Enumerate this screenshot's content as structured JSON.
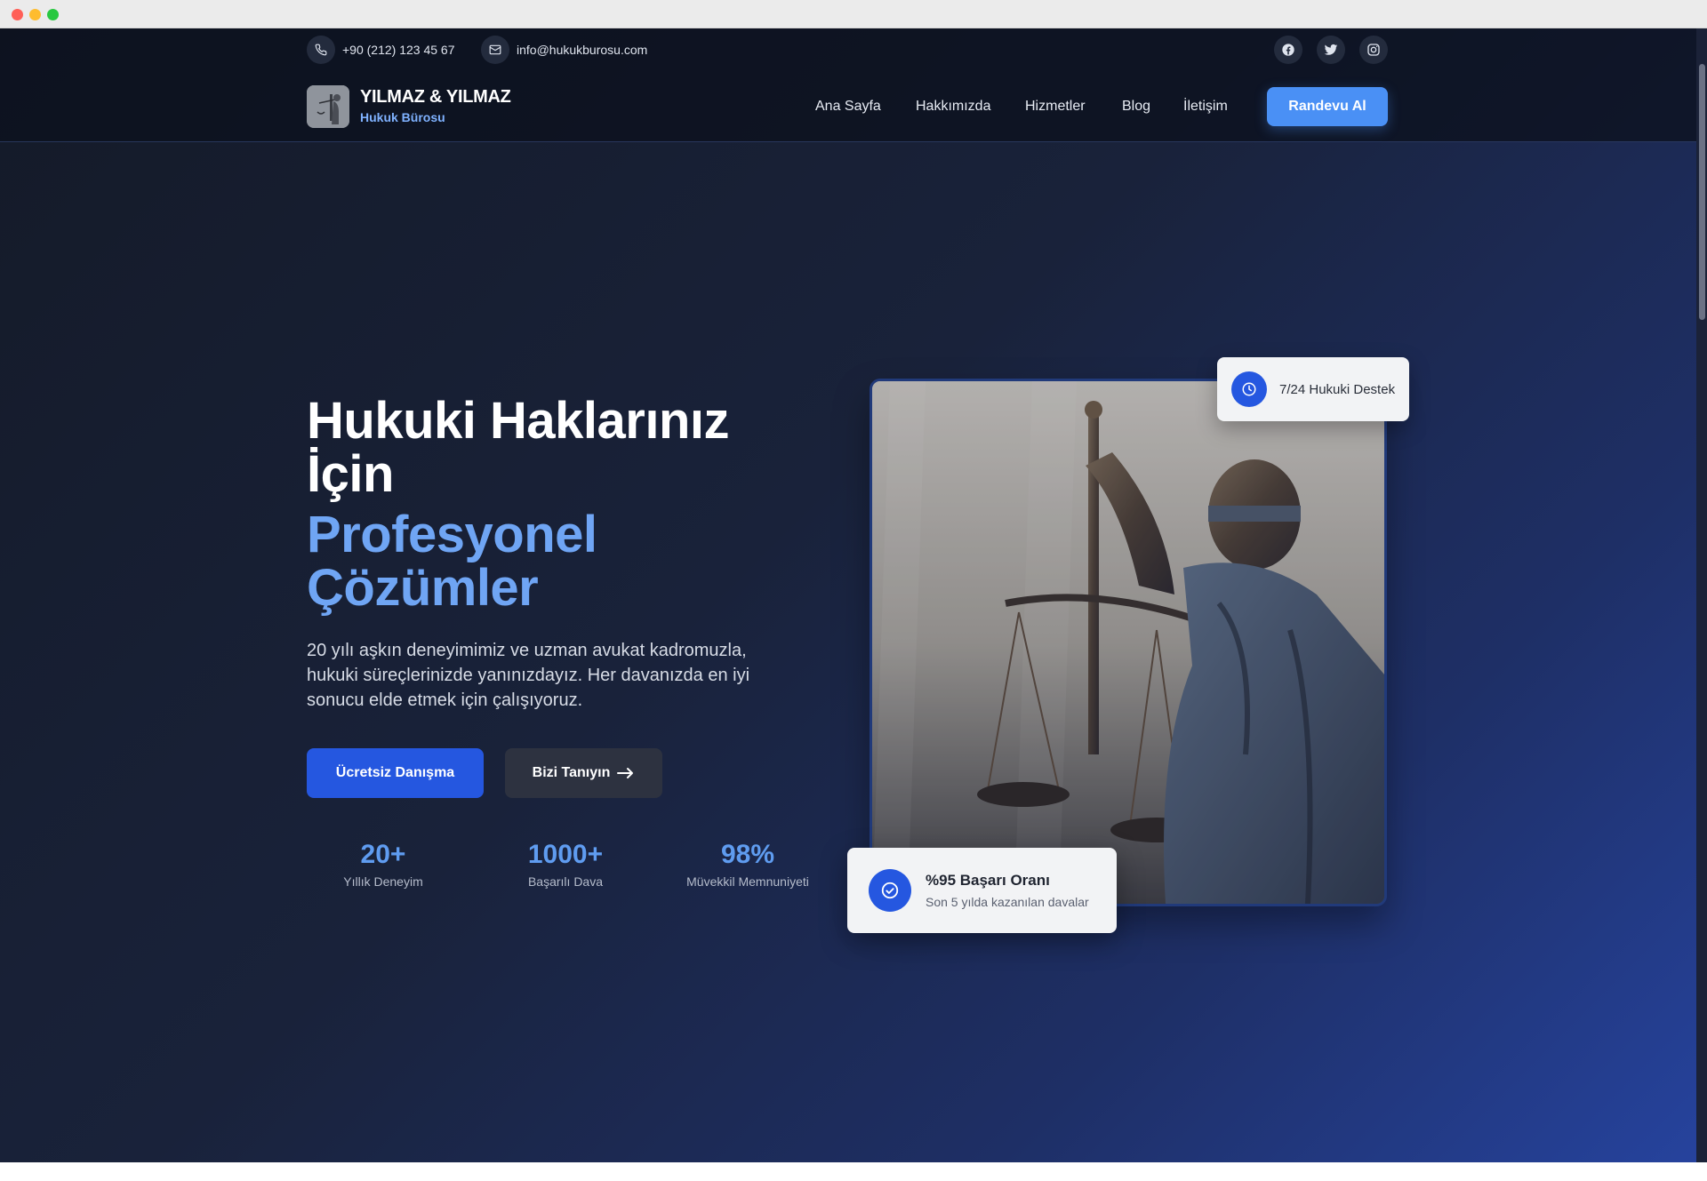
{
  "topbar": {
    "phone": "+90 (212) 123 45 67",
    "email": "info@hukukburosu.com",
    "social": [
      "facebook-icon",
      "twitter-icon",
      "instagram-icon"
    ]
  },
  "brand": {
    "name": "YILMAZ & YILMAZ",
    "tagline": "Hukuk Bürosu"
  },
  "nav": {
    "items": [
      {
        "label": "Ana Sayfa"
      },
      {
        "label": "Hakkımızda"
      },
      {
        "label": "Hizmetler"
      },
      {
        "label": "Blog"
      },
      {
        "label": "İletişim"
      }
    ],
    "cta_label": "Randevu Al"
  },
  "hero": {
    "title": "Hukuki Haklarınız İçin",
    "title_accent": "Profesyonel Çözümler",
    "lead": "20 yılı aşkın deneyimimiz ve uzman avukat kadromuzla, hukuki süreçlerinizde yanınızdayız. Her davanızda en iyi sonucu elde etmek için çalışıyoruz.",
    "primary_button": "Ücretsiz Danışma",
    "secondary_button": "Bizi Tanıyın",
    "stats": [
      {
        "value": "20+",
        "label": "Yıllık Deneyim"
      },
      {
        "value": "1000+",
        "label": "Başarılı Dava"
      },
      {
        "value": "98%",
        "label": "Müvekkil Memnuniyeti"
      }
    ]
  },
  "badges": {
    "support": "7/24 Hukuki Destek",
    "success_title": "%95 Başarı Oranı",
    "success_sub": "Son 5 yılda kazanılan davalar"
  },
  "colors": {
    "accent": "#4a90f5",
    "primary_button": "#2557e0",
    "accent_text": "#6fa5f4",
    "background_dark": "#141a28"
  }
}
